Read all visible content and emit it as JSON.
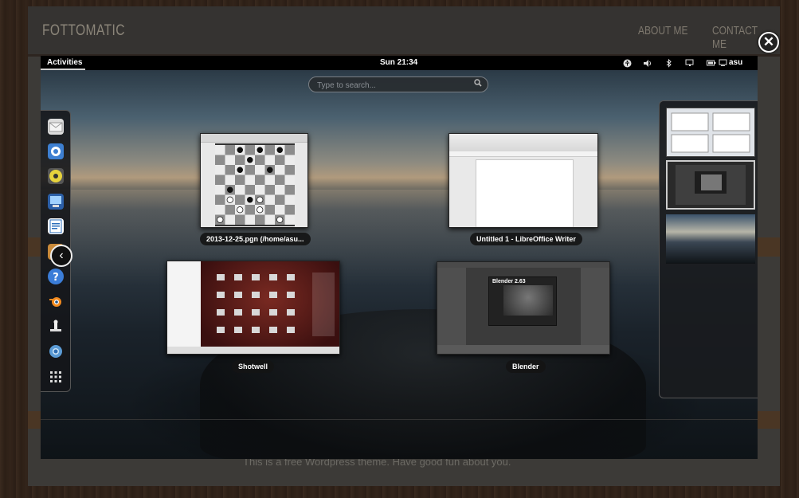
{
  "site": {
    "logo": "FOTTOMATIC",
    "nav": [
      "ABOUT ME",
      "CONTACT ME"
    ],
    "footer_text": "This is a free Wordpress theme. Have good fun about you."
  },
  "lightbox": {
    "close_icon": "close-icon",
    "topbar": {
      "activities_label": "Activities",
      "clock": "Sun 21:34",
      "tray_icons": [
        "accessibility-icon",
        "volume-icon",
        "bluetooth-icon",
        "display-icon",
        "battery-icon",
        "user-icon"
      ],
      "user": "asu"
    },
    "search": {
      "placeholder": "Type to search..."
    },
    "dash": {
      "apps": [
        "mail-app-icon",
        "empathy-app-icon",
        "rhythmbox-app-icon",
        "software-app-icon",
        "writer-app-icon",
        "files-app-icon",
        "help-app-icon",
        "blender-app-icon",
        "chess-app-icon",
        "chromium-app-icon",
        "show-apps-grid-icon"
      ],
      "collapse_icon": "chevron-left-icon"
    },
    "windows": [
      {
        "title": "2013-12-25.pgn (/home/asu..."
      },
      {
        "title": "Untitled 1 - LibreOffice Writer"
      },
      {
        "title": "Shotwell"
      },
      {
        "title": "Blender"
      }
    ],
    "blender_splash_text": "Blender 2.63",
    "workspaces": [
      "workspace-1",
      "workspace-2",
      "workspace-3"
    ],
    "colors": {
      "topbar": "#000000",
      "panel": "#1a1c1f",
      "accent": "#ffffff"
    }
  }
}
